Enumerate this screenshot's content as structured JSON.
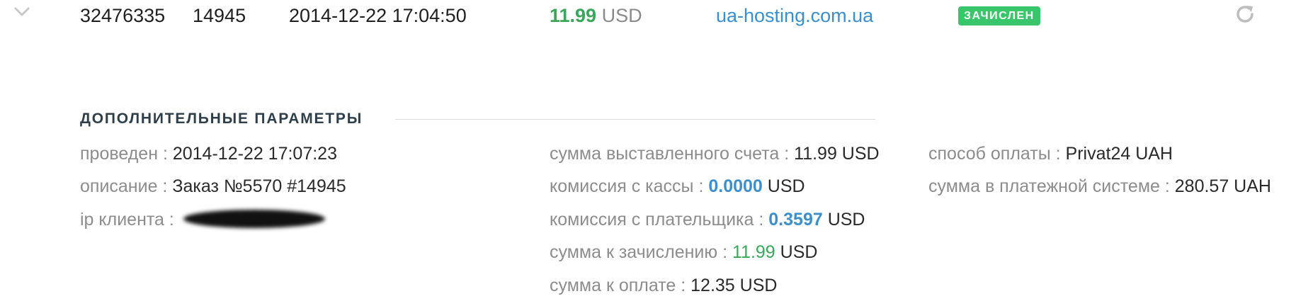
{
  "transaction": {
    "id": "32476335",
    "order": "14945",
    "datetime": "2014-12-22 17:04:50",
    "amount": "11.99",
    "currency": "USD",
    "site": "ua-hosting.com.ua",
    "status": "ЗАЧИСЛЕН"
  },
  "details": {
    "title": "ДОПОЛНИТЕЛЬНЫЕ ПАРАМЕТРЫ",
    "col1": [
      {
        "label": "проведен :",
        "value": "2014-12-22 17:07:23"
      },
      {
        "label": "описание :",
        "value": "Заказ №5570 #14945"
      },
      {
        "label": "ip клиента :",
        "value": ""
      }
    ],
    "col2": {
      "invoice": {
        "label": "сумма выставленного счета :",
        "value": "11.99 USD"
      },
      "cash_fee": {
        "label": "комиссия с кассы :",
        "num": "0.0000",
        "cur": "USD"
      },
      "payer_fee": {
        "label": "комиссия с плательщика :",
        "num": "0.3597",
        "cur": "USD"
      },
      "credit": {
        "label": "сумма к зачислению :",
        "num": "11.99",
        "cur": "USD"
      },
      "to_pay": {
        "label": "сумма к оплате :",
        "value": "12.35 USD"
      }
    },
    "col3": [
      {
        "label": "способ оплаты :",
        "value": "Privat24 UAH"
      },
      {
        "label": "сумма в платежной системе :",
        "value": "280.57 UAH"
      }
    ]
  },
  "colors": {
    "green": "#3aa65a",
    "blue": "#3b8fcd",
    "badge": "#39c56a",
    "label_gray": "#8c8c8c"
  },
  "icons": {
    "expand": "chevron-down-icon",
    "refresh": "refresh-icon"
  }
}
